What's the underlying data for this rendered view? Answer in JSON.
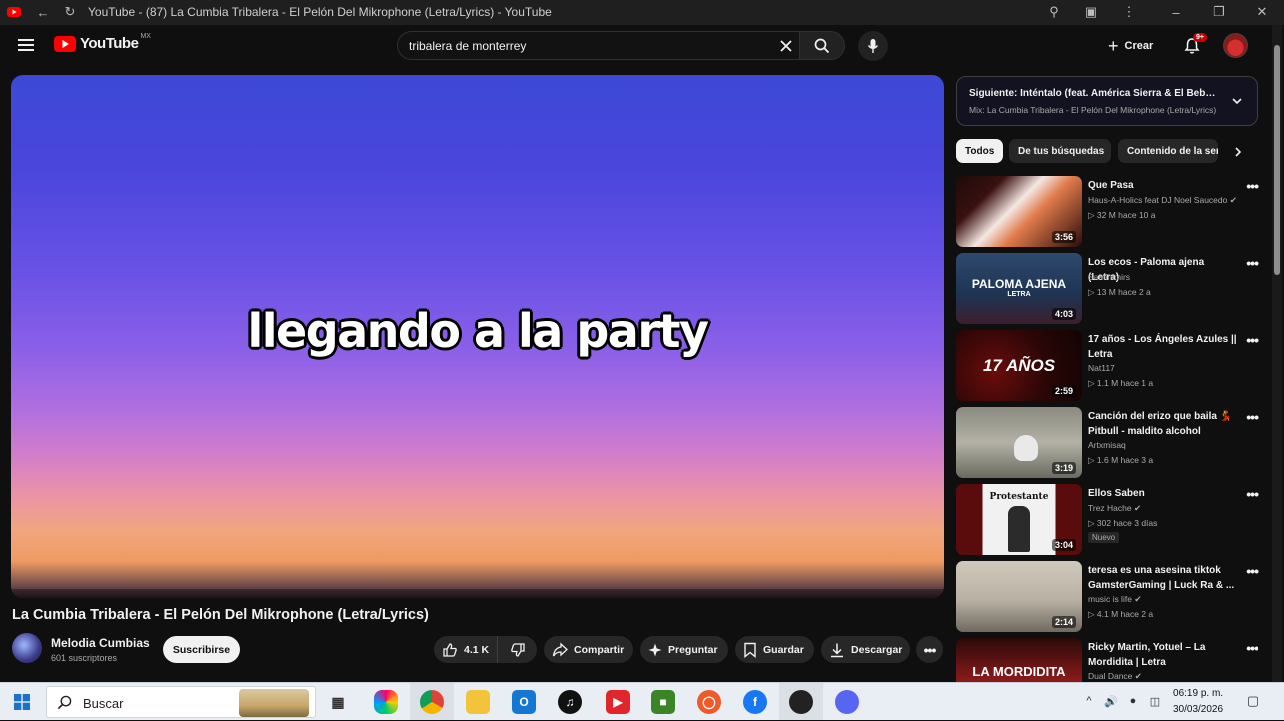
{
  "browser": {
    "tab_title": "YouTube - (87) La Cumbia Tribalera - El Pelón Del Mikrophone (Letra/Lyrics) - YouTube"
  },
  "masthead": {
    "logo_text": "YouTube",
    "logo_country": "MX",
    "search_query": "tribalera de monterrey",
    "create_label": "Crear",
    "notifications_badge": "9+"
  },
  "video": {
    "lyric_overlay": "llegando a la party",
    "title": "La Cumbia Tribalera - El Pelón Del Mikrophone (Letra/Lyrics)",
    "channel_name": "Melodia Cumbias",
    "channel_subs": "601 suscriptores",
    "subscribe_label": "Suscribirse",
    "likes": "4.1 K",
    "share_label": "Compartir",
    "ask_label": "Preguntar",
    "save_label": "Guardar",
    "download_label": "Descargar"
  },
  "sidebar": {
    "next_title": "Siguiente: Inténtalo (feat. América Sierra & El Bebeto)",
    "next_sub": "Mix: La Cumbia Tribalera - El Pelón Del Mikrophone (Letra/Lyrics)",
    "chips": [
      "Todos",
      "De tus búsquedas",
      "Contenido de la serie"
    ],
    "related": [
      {
        "title": "Que Pasa",
        "channel": "Haus-A-Holics feat DJ Noel Saucedo",
        "verified": true,
        "meta": "▷ 32 M  hace 10 a",
        "duration": "3:56",
        "badge": ""
      },
      {
        "title": "Los ecos - Paloma ajena (Letra)",
        "channel": "Santinimirs",
        "verified": false,
        "meta": "▷ 13 M  hace 2 a",
        "duration": "4:03",
        "badge": "",
        "thumb_text": "PALOMA AJENA",
        "thumb_sub": "LETRA"
      },
      {
        "title": "17 años - Los Ángeles Azules || Letra",
        "channel": "Nat117",
        "verified": false,
        "meta": "▷ 1.1 M  hace 1 a",
        "duration": "2:59",
        "badge": "",
        "thumb_text": "17 AÑOS"
      },
      {
        "title": "Canción del erizo que baila 💃 Pitbull - maldito alcohol",
        "channel": "Artxmisaq",
        "verified": false,
        "meta": "▷ 1.6 M  hace 3 a",
        "duration": "3:19",
        "badge": ""
      },
      {
        "title": "Ellos Saben",
        "channel": "Trez Hache",
        "verified": true,
        "meta": "▷ 302  hace 3 días",
        "duration": "3:04",
        "badge": "Nuevo",
        "thumb_text": "Protestante"
      },
      {
        "title": "teresa es una asesina tiktok GamsterGaming | Luck Ra & ...",
        "channel": "music is life",
        "verified": true,
        "meta": "▷ 4.1 M  hace 2 a",
        "duration": "2:14",
        "badge": ""
      },
      {
        "title": "Ricky Martin, Yotuel – La Mordidita | Letra",
        "channel": "Dual Dance",
        "verified": true,
        "meta": "",
        "duration": "",
        "badge": "",
        "thumb_text": "LA MORDIDITA"
      }
    ]
  },
  "taskbar": {
    "search_placeholder": "Buscar",
    "time": "06:19 p. m.",
    "date": "30/03/2026"
  },
  "colors": {
    "youtube_red": "#ff0000",
    "background": "#0f0f0f",
    "chip_bg": "#272727"
  }
}
